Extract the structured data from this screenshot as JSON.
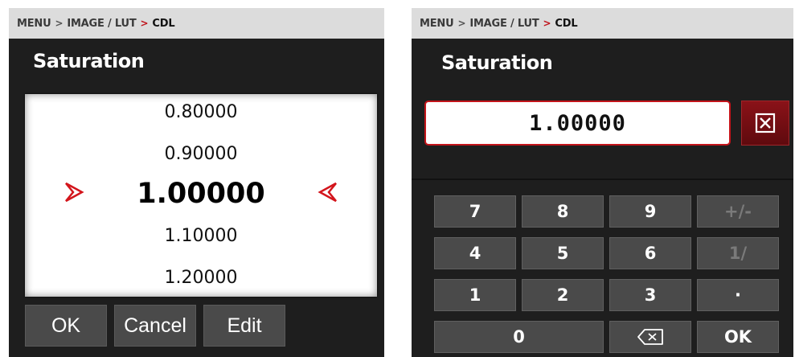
{
  "left": {
    "breadcrumb": {
      "menu": "MENU",
      "section": "IMAGE / LUT",
      "current": "CDL"
    },
    "title": "Saturation",
    "values": [
      "0.80000",
      "0.90000",
      "1.00000",
      "1.10000",
      "1.20000"
    ],
    "selected_value": "1.00000",
    "buttons": {
      "ok": "OK",
      "cancel": "Cancel",
      "edit": "Edit"
    }
  },
  "right": {
    "breadcrumb": {
      "menu": "MENU",
      "section": "IMAGE / LUT",
      "current": "CDL"
    },
    "title": "Saturation",
    "input_value": "1.00000",
    "keys": {
      "k7": "7",
      "k8": "8",
      "k9": "9",
      "plus_minus": "+/-",
      "k4": "4",
      "k5": "5",
      "k6": "6",
      "one_over": "1/",
      "k1": "1",
      "k2": "2",
      "k3": "3",
      "dot": "·",
      "k0": "0",
      "ok": "OK"
    }
  },
  "colors": {
    "accent_red": "#c3141a",
    "panel_bg": "#1e1e1e",
    "button_bg": "#4a4a4a"
  },
  "icons": {
    "clear": "clear-x-icon",
    "backspace": "backspace-icon",
    "selection_arrow": "red-chevron-icon"
  }
}
